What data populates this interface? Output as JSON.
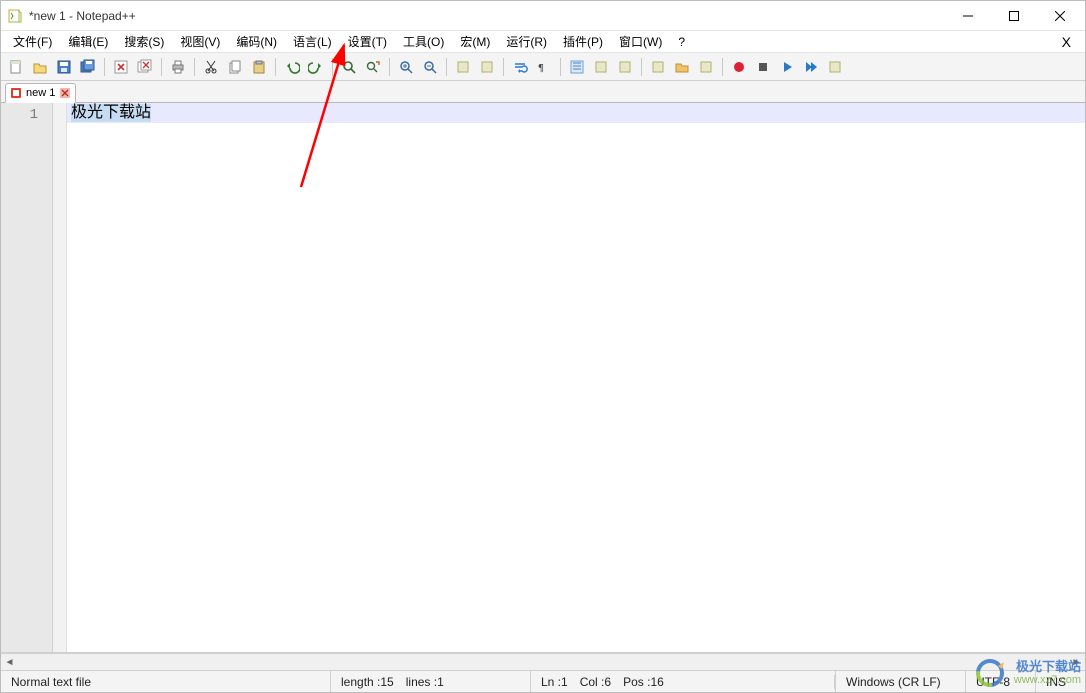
{
  "title": "*new 1 - Notepad++",
  "menu": {
    "file": "文件(F)",
    "edit": "编辑(E)",
    "search": "搜索(S)",
    "view": "视图(V)",
    "encoding": "编码(N)",
    "language": "语言(L)",
    "settings": "设置(T)",
    "tools": "工具(O)",
    "macro": "宏(M)",
    "run": "运行(R)",
    "plugins": "插件(P)",
    "window": "窗口(W)",
    "help": "?"
  },
  "toolbar_icons": [
    "new-file-icon",
    "open-file-icon",
    "save-icon",
    "save-all-icon",
    "sep",
    "close-icon",
    "close-all-icon",
    "sep",
    "print-icon",
    "sep",
    "cut-icon",
    "copy-icon",
    "paste-icon",
    "sep",
    "undo-icon",
    "redo-icon",
    "sep",
    "find-icon",
    "replace-icon",
    "sep",
    "zoom-in-icon",
    "zoom-out-icon",
    "sep",
    "sync-v-icon",
    "sync-h-icon",
    "sep",
    "wordwrap-icon",
    "show-all-icon",
    "sep",
    "indent-guide-icon",
    "lang-icon",
    "doc-map-icon",
    "sep",
    "func-list-icon",
    "folder-icon",
    "monitor-icon",
    "sep",
    "record-icon",
    "stop-icon",
    "play-icon",
    "play-multi-icon",
    "save-macro-icon"
  ],
  "tab": {
    "label": "new 1"
  },
  "editor": {
    "line1_number": "1",
    "line1_text": "极光下载站"
  },
  "status": {
    "filetype": "Normal text file",
    "length_label": "length : ",
    "length_value": "15",
    "lines_label": "lines : ",
    "lines_value": "1",
    "ln_label": "Ln : ",
    "ln_value": "1",
    "col_label": "Col : ",
    "col_value": "6",
    "pos_label": "Pos : ",
    "pos_value": "16",
    "eol": "Windows (CR LF)",
    "encoding": "UTF-8",
    "mode": "INS"
  },
  "watermark": {
    "cn": "极光下载站",
    "url": "www.xz7.com"
  }
}
